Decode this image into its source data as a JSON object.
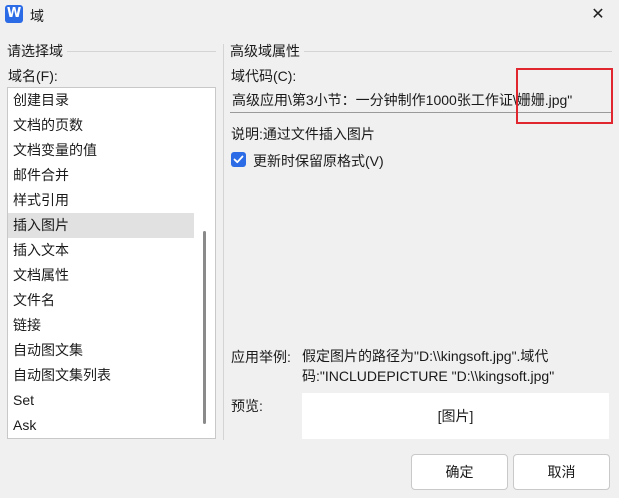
{
  "window": {
    "title": "域",
    "app_icon_letter": "W",
    "close_glyph": "✕"
  },
  "left": {
    "group_title": "请选择域",
    "field_name_label": "域名(F):",
    "items": [
      {
        "label": "创建目录",
        "selected": false
      },
      {
        "label": "文档的页数",
        "selected": false
      },
      {
        "label": "文档变量的值",
        "selected": false
      },
      {
        "label": "邮件合并",
        "selected": false
      },
      {
        "label": "样式引用",
        "selected": false
      },
      {
        "label": "插入图片",
        "selected": true
      },
      {
        "label": "插入文本",
        "selected": false
      },
      {
        "label": "文档属性",
        "selected": false
      },
      {
        "label": "文件名",
        "selected": false
      },
      {
        "label": "链接",
        "selected": false
      },
      {
        "label": "自动图文集",
        "selected": false
      },
      {
        "label": "自动图文集列表",
        "selected": false
      },
      {
        "label": "Set",
        "selected": false
      },
      {
        "label": "Ask",
        "selected": false
      }
    ]
  },
  "right": {
    "group_title": "高级域属性",
    "code_label": "域代码(C):",
    "code_value": "高级应用\\第3小节：一分钟制作1000张工作证\\姗姗.jpg\"",
    "description": "说明:通过文件插入图片",
    "keep_format_checkbox": {
      "label": "更新时保留原格式(V)",
      "checked": true
    },
    "example_label": "应用举例:",
    "example_text": "假定图片的路径为\"D:\\\\kingsoft.jpg\".域代码:\"INCLUDEPICTURE \"D:\\\\kingsoft.jpg\"",
    "preview_label": "预览:",
    "preview_value": "[图片]"
  },
  "buttons": {
    "ok": "确定",
    "cancel": "取消"
  },
  "colors": {
    "accent": "#2b6be6",
    "highlight_box": "#e0262e",
    "selected_row": "#e1e1e1"
  }
}
